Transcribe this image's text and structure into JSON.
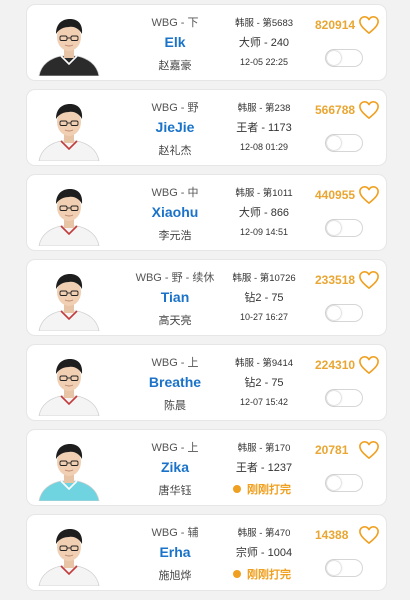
{
  "colors": {
    "name": "#1a73c9",
    "score": "#e9a632",
    "status": "#f0a020"
  },
  "players": [
    {
      "team_role": "WBG - 下",
      "name": "Elk",
      "real_name": "赵嘉豪",
      "server": "韩服 - 第5683",
      "rank": "大师 - 240",
      "time": "12-05 22:25",
      "status": "",
      "score": "820914",
      "jersey": "dark"
    },
    {
      "team_role": "WBG - 野",
      "name": "JieJie",
      "real_name": "赵礼杰",
      "server": "韩服 - 第238",
      "rank": "王者 - 1173",
      "time": "12-08 01:29",
      "status": "",
      "score": "566788",
      "jersey": "white"
    },
    {
      "team_role": "WBG - 中",
      "name": "Xiaohu",
      "real_name": "李元浩",
      "server": "韩服 - 第1011",
      "rank": "大师 - 866",
      "time": "12-09 14:51",
      "status": "",
      "score": "440955",
      "jersey": "white"
    },
    {
      "team_role": "WBG - 野 - 续休",
      "name": "Tian",
      "real_name": "高天亮",
      "server": "韩服 - 第10726",
      "rank": "钻2 - 75",
      "time": "10-27 16:27",
      "status": "",
      "score": "233518",
      "jersey": "white"
    },
    {
      "team_role": "WBG - 上",
      "name": "Breathe",
      "real_name": "陈晨",
      "server": "韩服 - 第9414",
      "rank": "钻2 - 75",
      "time": "12-07 15:42",
      "status": "",
      "score": "224310",
      "jersey": "white"
    },
    {
      "team_role": "WBG - 上",
      "name": "Zika",
      "real_name": "唐华钰",
      "server": "韩服 - 第170",
      "rank": "王者 - 1237",
      "time": "",
      "status": "刚刚打完",
      "score": "20781",
      "jersey": "teal"
    },
    {
      "team_role": "WBG - 辅",
      "name": "Erha",
      "real_name": "施旭烨",
      "server": "韩服 - 第470",
      "rank": "宗师 - 1004",
      "time": "",
      "status": "刚刚打完",
      "score": "14388",
      "jersey": "white"
    }
  ]
}
